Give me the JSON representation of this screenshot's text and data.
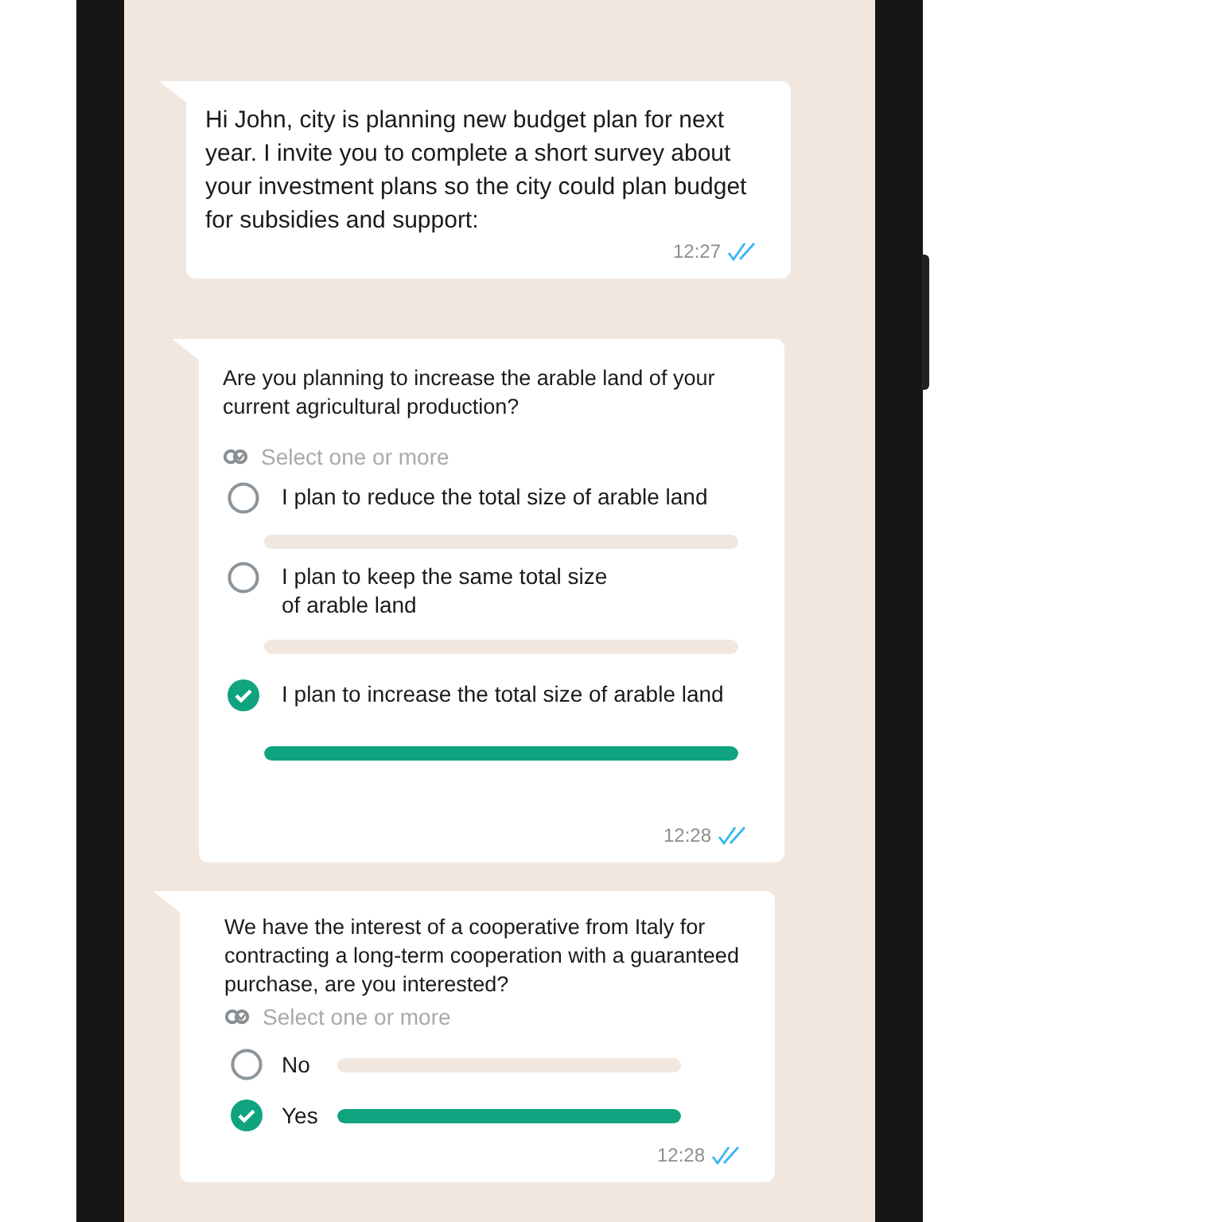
{
  "messages": [
    {
      "kind": "text",
      "text": "Hi John, city is planning new budget plan for next year. I invite you to complete a short survey about your investment plans so the city could plan budget for subsidies and support:",
      "time": "12:27",
      "read": true
    },
    {
      "kind": "poll",
      "question": "Are you planning to increase the arable land of your current agricultural production?",
      "hint": "Select one or more",
      "options": [
        {
          "label": "I plan to reduce the total size of arable land",
          "selected": false
        },
        {
          "label": "I plan to keep the same total size\nof arable land",
          "selected": false
        },
        {
          "label": "I plan to increase the total size of arable land",
          "selected": true,
          "level": 1
        }
      ],
      "time": "12:28",
      "read": true
    },
    {
      "kind": "poll-compact",
      "question": "We have the interest of a cooperative from Italy for contracting a long-term cooperation with a guaranteed purchase, are you interested?",
      "hint": "Select one or more",
      "options": [
        {
          "label": "No",
          "selected": false
        },
        {
          "label": "Yes",
          "selected": true,
          "level": 1
        }
      ],
      "time": "12:28",
      "read": true
    }
  ]
}
